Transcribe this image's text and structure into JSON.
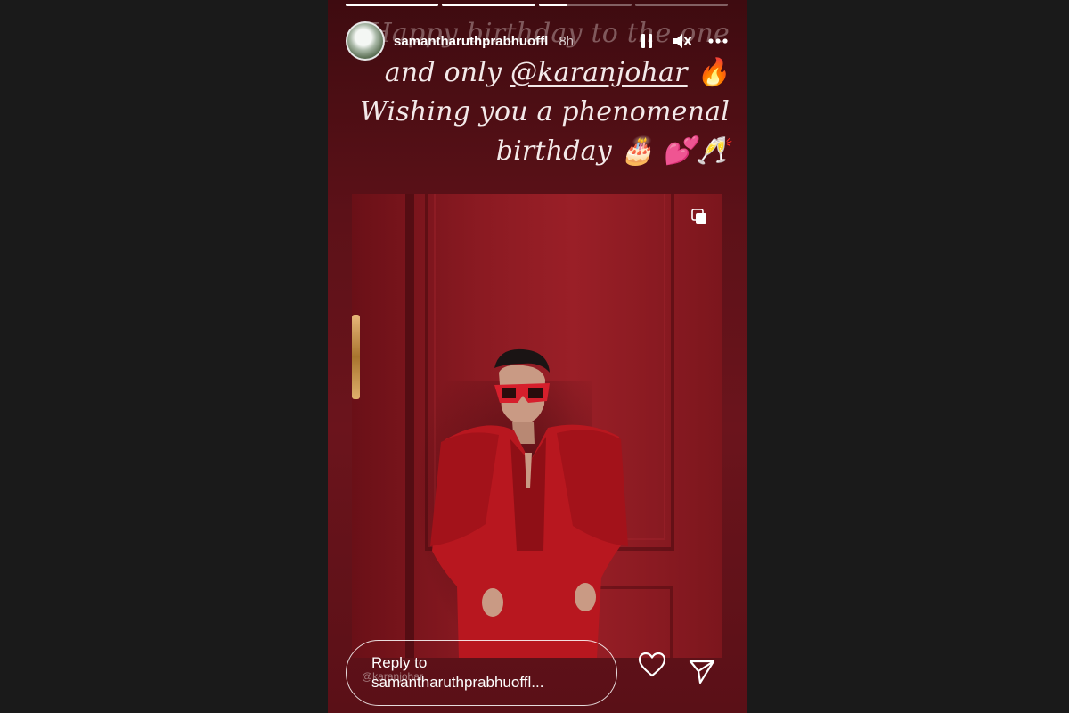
{
  "story": {
    "progress": [
      1,
      1,
      0.3,
      0
    ],
    "caption": {
      "line1": "Happy birthday to the one",
      "line2_prefix": "and only ",
      "line2_mention": "@karanjohar",
      "line2_emoji": "🔥",
      "line3": "Wishing you a phenomenal",
      "line4": "birthday 🎂 💕🥂"
    },
    "header": {
      "username": "samantharuthprabhuoffl",
      "time": "8h",
      "icons": [
        "pause-icon",
        "mute-icon",
        "more-icon"
      ]
    },
    "photo": {
      "watermark": "@karanjohar",
      "icon": "multiple-posts-icon"
    },
    "reply": {
      "line1": "Reply to",
      "line2": "samantharuthprabhuoffl..."
    },
    "actions": [
      "heart-icon",
      "send-icon"
    ]
  }
}
